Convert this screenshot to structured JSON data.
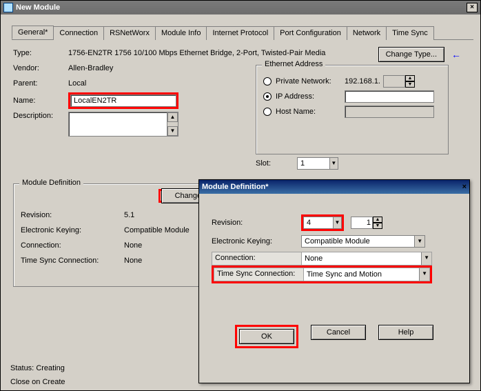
{
  "window": {
    "title": "New Module",
    "tabs": {
      "general": "General*",
      "connection": "Connection",
      "rsnetworx": "RSNetWorx",
      "moduleinfo": "Module Info",
      "internet": "Internet Protocol",
      "portconfig": "Port Configuration",
      "network": "Network",
      "timesync": "Time Sync"
    },
    "labels": {
      "type": "Type:",
      "vendor": "Vendor:",
      "parent": "Parent:",
      "name": "Name:",
      "description": "Description:",
      "change_type": "Change Type...",
      "status_label": "Status:",
      "close_on_create": "Close on Create"
    },
    "values": {
      "type": "1756-EN2TR 1756 10/100 Mbps Ethernet Bridge, 2-Port, Twisted-Pair Media",
      "vendor": "Allen-Bradley",
      "parent": "Local",
      "name": "LocalEN2TR",
      "description": "",
      "status": "Creating"
    },
    "ethernet": {
      "legend": "Ethernet Address",
      "private_label": "Private Network:",
      "private_prefix": "192.168.1.",
      "private_value": "",
      "ip_label": "IP Address:",
      "ip_value": "",
      "host_label": "Host Name:",
      "host_value": ""
    },
    "slot": {
      "label": "Slot:",
      "value": "1"
    },
    "module_def": {
      "legend": "Module Definition",
      "change_btn": "Change ...",
      "revision_label": "Revision:",
      "revision_value": "5.1",
      "keying_label": "Electronic Keying:",
      "keying_value": "Compatible Module",
      "connection_label": "Connection:",
      "connection_value": "None",
      "tsc_label": "Time Sync Connection:",
      "tsc_value": "None"
    }
  },
  "modal": {
    "title": "Module Definition*",
    "revision_label": "Revision:",
    "revision_major": "4",
    "revision_minor": "1",
    "keying_label": "Electronic Keying:",
    "keying_value": "Compatible Module",
    "connection_label": "Connection:",
    "connection_value": "None",
    "tsc_label": "Time Sync Connection:",
    "tsc_value": "Time Sync and Motion",
    "btn_ok": "OK",
    "btn_cancel": "Cancel",
    "btn_help": "Help"
  }
}
